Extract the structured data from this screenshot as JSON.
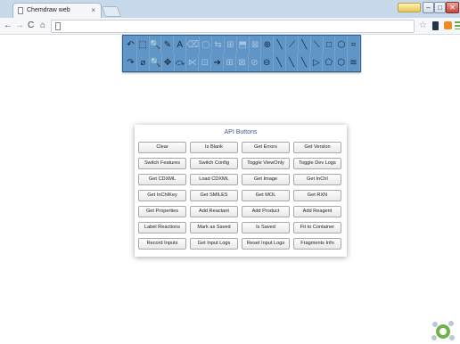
{
  "browser": {
    "tab_title": "Chemdraw web",
    "tab_close": "×",
    "nav": {
      "back": "←",
      "forward": "→",
      "reload": "C",
      "home": "⌂"
    },
    "star": "☆",
    "window": {
      "minimize": "–",
      "maximize": "□",
      "close": "✕"
    }
  },
  "chem_toolbar": {
    "row1": [
      "↶",
      "⬚",
      "🔍",
      "✎",
      "A",
      "⌫",
      "▢",
      "⇆",
      "⊞",
      "⬒",
      "⊠",
      "⊕",
      "╲",
      "⟋",
      "╲",
      "⟍",
      "□",
      "⬡",
      "≈"
    ],
    "row2": [
      "↷",
      "⌀",
      "🔍",
      "✥",
      "⤼",
      "⋉",
      "⊡",
      "➔",
      "⊞",
      "⊠",
      "⊘",
      "⊖",
      "╲",
      "╲",
      "╲",
      "▷",
      "⬠",
      "⬡",
      "≋"
    ]
  },
  "api_panel": {
    "title": "API Buttons",
    "buttons": [
      "Clear",
      "Is Blank",
      "Get Errors",
      "Get Version",
      "Switch Features",
      "Switch Config",
      "Toggle ViewOnly",
      "Toggle Dev Logs",
      "Get CDXML",
      "Load CDXML",
      "Get Image",
      "Get InChI",
      "Get InChIKey",
      "Get SMILES",
      "Get MOL",
      "Get RXN",
      "Get Properties",
      "Add Reactant",
      "Add Product",
      "Add Reagent",
      "Label Reactions",
      "Mark as Saved",
      "Is Saved",
      "Fit to Container",
      "Record Inputs",
      "Get Input Logs",
      "Reset Input Logs",
      "Fragments Info"
    ]
  },
  "colors": {
    "toolbar_bg": "#5f95c7",
    "panel_title": "#3a5a8a",
    "titlebar": "#c9d9ec"
  }
}
